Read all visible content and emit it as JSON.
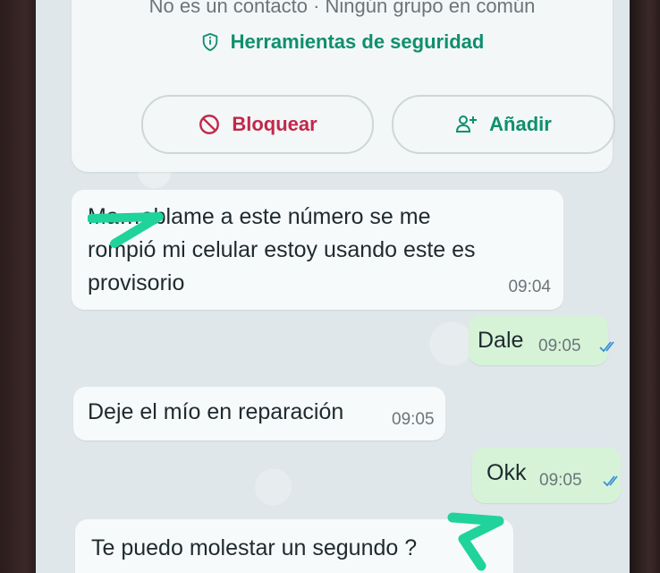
{
  "contact_info": {
    "subtitle": "No es un contacto · Ningún grupo en común",
    "security_tools_label": "Herramientas de seguridad",
    "block_button_label": "Bloquear",
    "add_button_label": "Añadir"
  },
  "messages": [
    {
      "direction": "incoming",
      "text_line1": "Ma…ablame a este número se me",
      "text_line2": "rompió mi celular estoy usando este es",
      "text_line3": "provisorio",
      "time": "09:04"
    },
    {
      "direction": "outgoing",
      "text": "Dale",
      "time": "09:05",
      "status": "read"
    },
    {
      "direction": "incoming",
      "text": "Deje el mío en reparación",
      "time": "09:05"
    },
    {
      "direction": "outgoing",
      "text": "Okk",
      "time": "09:05",
      "status": "read"
    },
    {
      "direction": "incoming",
      "text": "Te puedo molestar un segundo ?"
    }
  ],
  "colors": {
    "accent_green": "#0f8f6d",
    "block_red": "#c1284a",
    "outgoing_bubble": "#d6f3d8",
    "incoming_bubble": "#f7fafb",
    "read_ticks": "#3a8fd6",
    "redaction_marker": "#1fd39a"
  }
}
